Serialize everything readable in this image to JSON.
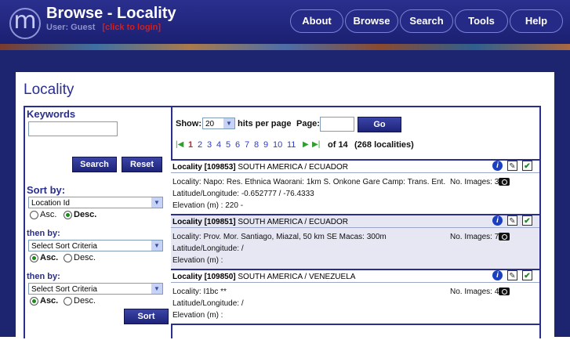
{
  "header": {
    "title": "Browse - Locality",
    "user_label": "User: Guest",
    "login_link": "[click to login]",
    "logo_glyph": "m",
    "nav": [
      "About",
      "Browse",
      "Search",
      "Tools",
      "Help"
    ]
  },
  "page": {
    "title": "Locality"
  },
  "left": {
    "keywords_label": "Keywords",
    "keywords_value": "",
    "search_btn": "Search",
    "reset_btn": "Reset",
    "sort_by_label": "Sort by:",
    "sort1": "Location Id",
    "then_by_label": "then by:",
    "sort2": "Select Sort Criteria",
    "sort3": "Select Sort Criteria",
    "asc": "Asc.",
    "desc": "Desc.",
    "sort_btn": "Sort"
  },
  "results": {
    "show_label": "Show:",
    "hits_value": "20",
    "hits_label": "hits per page",
    "page_label": "Page:",
    "go_btn": "Go",
    "pages": [
      "1",
      "2",
      "3",
      "4",
      "5",
      "6",
      "7",
      "8",
      "9",
      "10",
      "11"
    ],
    "current_page": "1",
    "of_label": "of 14",
    "count_label": "(268 localities)",
    "records": [
      {
        "head_id": "Locality [109853]",
        "head_loc": "SOUTH AMERICA / ECUADOR",
        "locality": "Locality: Napo: Res. Ethnica Waorani: 1km S. Onkone Gare Camp: Trans. Ent.",
        "latlon": "Latitude/Longitude: -0.652777 / -76.4333",
        "elev": "Elevation (m) : 220 -",
        "images": "No. Images: 3"
      },
      {
        "head_id": "Locality [109851]",
        "head_loc": "SOUTH AMERICA / ECUADOR",
        "locality": "Locality: Prov. Mor. Santiago, Miazal, 50 km SE Macas: 300m",
        "latlon": "Latitude/Longitude:  /",
        "elev": "Elevation (m) :",
        "images": "No. Images: 7"
      },
      {
        "head_id": "Locality [109850]",
        "head_loc": "SOUTH AMERICA / VENEZUELA",
        "locality": "Locality: I1bc **",
        "latlon": "Latitude/Longitude:  /",
        "elev": "Elevation (m) :",
        "images": "No. Images: 4"
      }
    ]
  },
  "icons": {
    "info": "i",
    "edit": "✎",
    "check": "✔"
  },
  "colors": {
    "brand": "#2a2f8e",
    "link": "#2b3ccc",
    "current_page": "#d21f1f",
    "alt_row": "#e6e7f3"
  }
}
